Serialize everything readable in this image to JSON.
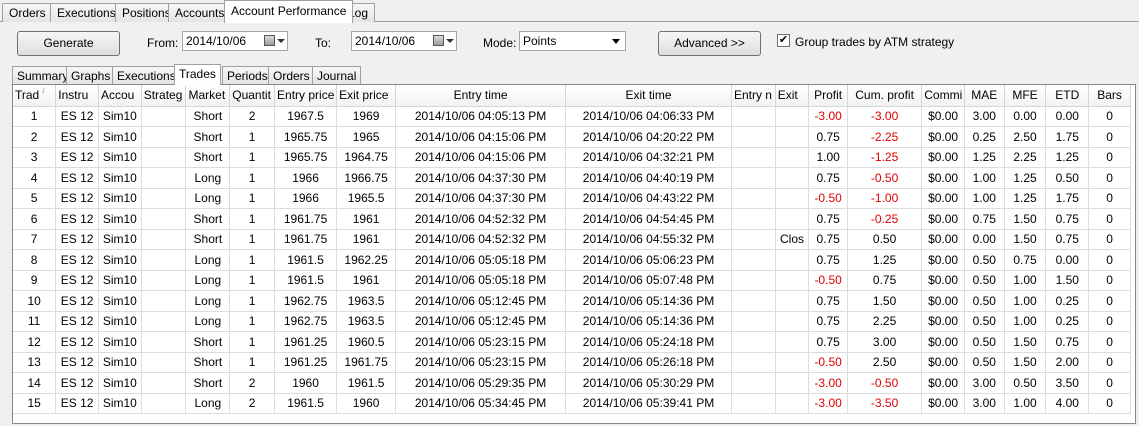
{
  "top_tabs": [
    "Orders",
    "Executions",
    "Positions",
    "Accounts",
    "Account Performance",
    "Log"
  ],
  "active_top_tab": "Account Performance",
  "toolbar": {
    "generate_label": "Generate",
    "from_label": "From:",
    "from_value": "2014/10/06",
    "to_label": "To:",
    "to_value": "2014/10/06",
    "mode_label": "Mode:",
    "mode_value": "Points",
    "advanced_label": "Advanced >>",
    "group_checkbox_label": "Group trades by ATM strategy",
    "group_checked": true
  },
  "sub_tabs": [
    "Summary",
    "Graphs",
    "Executions",
    "Trades",
    "Periods",
    "Orders",
    "Journal"
  ],
  "active_sub_tab": "Trades",
  "colors": {
    "negative": "#e00000"
  },
  "table": {
    "columns": [
      "Trad",
      "Instru",
      "Accou",
      "Strateg",
      "Market",
      "Quantit",
      "Entry price",
      "Exit price",
      "Entry time",
      "Exit time",
      "Entry n",
      "Exit",
      "Profit",
      "Cum. profit",
      "Commi",
      "MAE",
      "MFE",
      "ETD",
      "Bars"
    ],
    "rows": [
      [
        "1",
        "ES 12",
        "Sim10",
        "",
        "Short",
        "2",
        "1967.5",
        "1969",
        "2014/10/06 04:05:13 PM",
        "2014/10/06 04:06:33 PM",
        "",
        "",
        "-3.00",
        "-3.00",
        "$0.00",
        "3.00",
        "0.00",
        "0.00",
        "0"
      ],
      [
        "2",
        "ES 12",
        "Sim10",
        "",
        "Short",
        "1",
        "1965.75",
        "1965",
        "2014/10/06 04:15:06 PM",
        "2014/10/06 04:20:22 PM",
        "",
        "",
        "0.75",
        "-2.25",
        "$0.00",
        "0.25",
        "2.50",
        "1.75",
        "0"
      ],
      [
        "3",
        "ES 12",
        "Sim10",
        "",
        "Short",
        "1",
        "1965.75",
        "1964.75",
        "2014/10/06 04:15:06 PM",
        "2014/10/06 04:32:21 PM",
        "",
        "",
        "1.00",
        "-1.25",
        "$0.00",
        "1.25",
        "2.25",
        "1.25",
        "0"
      ],
      [
        "4",
        "ES 12",
        "Sim10",
        "",
        "Long",
        "1",
        "1966",
        "1966.75",
        "2014/10/06 04:37:30 PM",
        "2014/10/06 04:40:19 PM",
        "",
        "",
        "0.75",
        "-0.50",
        "$0.00",
        "1.00",
        "1.25",
        "0.50",
        "0"
      ],
      [
        "5",
        "ES 12",
        "Sim10",
        "",
        "Long",
        "1",
        "1966",
        "1965.5",
        "2014/10/06 04:37:30 PM",
        "2014/10/06 04:43:22 PM",
        "",
        "",
        "-0.50",
        "-1.00",
        "$0.00",
        "1.00",
        "1.25",
        "1.75",
        "0"
      ],
      [
        "6",
        "ES 12",
        "Sim10",
        "",
        "Short",
        "1",
        "1961.75",
        "1961",
        "2014/10/06 04:52:32 PM",
        "2014/10/06 04:54:45 PM",
        "",
        "",
        "0.75",
        "-0.25",
        "$0.00",
        "0.75",
        "1.50",
        "0.75",
        "0"
      ],
      [
        "7",
        "ES 12",
        "Sim10",
        "",
        "Short",
        "1",
        "1961.75",
        "1961",
        "2014/10/06 04:52:32 PM",
        "2014/10/06 04:55:32 PM",
        "",
        "Clos",
        "0.75",
        "0.50",
        "$0.00",
        "0.00",
        "1.50",
        "0.75",
        "0"
      ],
      [
        "8",
        "ES 12",
        "Sim10",
        "",
        "Long",
        "1",
        "1961.5",
        "1962.25",
        "2014/10/06 05:05:18 PM",
        "2014/10/06 05:06:23 PM",
        "",
        "",
        "0.75",
        "1.25",
        "$0.00",
        "0.50",
        "0.75",
        "0.00",
        "0"
      ],
      [
        "9",
        "ES 12",
        "Sim10",
        "",
        "Long",
        "1",
        "1961.5",
        "1961",
        "2014/10/06 05:05:18 PM",
        "2014/10/06 05:07:48 PM",
        "",
        "",
        "-0.50",
        "0.75",
        "$0.00",
        "0.50",
        "1.00",
        "1.50",
        "0"
      ],
      [
        "10",
        "ES 12",
        "Sim10",
        "",
        "Long",
        "1",
        "1962.75",
        "1963.5",
        "2014/10/06 05:12:45 PM",
        "2014/10/06 05:14:36 PM",
        "",
        "",
        "0.75",
        "1.50",
        "$0.00",
        "0.50",
        "1.00",
        "0.25",
        "0"
      ],
      [
        "11",
        "ES 12",
        "Sim10",
        "",
        "Long",
        "1",
        "1962.75",
        "1963.5",
        "2014/10/06 05:12:45 PM",
        "2014/10/06 05:14:36 PM",
        "",
        "",
        "0.75",
        "2.25",
        "$0.00",
        "0.50",
        "1.00",
        "0.25",
        "0"
      ],
      [
        "12",
        "ES 12",
        "Sim10",
        "",
        "Short",
        "1",
        "1961.25",
        "1960.5",
        "2014/10/06 05:23:15 PM",
        "2014/10/06 05:24:18 PM",
        "",
        "",
        "0.75",
        "3.00",
        "$0.00",
        "0.50",
        "1.50",
        "0.75",
        "0"
      ],
      [
        "13",
        "ES 12",
        "Sim10",
        "",
        "Short",
        "1",
        "1961.25",
        "1961.75",
        "2014/10/06 05:23:15 PM",
        "2014/10/06 05:26:18 PM",
        "",
        "",
        "-0.50",
        "2.50",
        "$0.00",
        "0.50",
        "1.50",
        "2.00",
        "0"
      ],
      [
        "14",
        "ES 12",
        "Sim10",
        "",
        "Short",
        "2",
        "1960",
        "1961.5",
        "2014/10/06 05:29:35 PM",
        "2014/10/06 05:30:29 PM",
        "",
        "",
        "-3.00",
        "-0.50",
        "$0.00",
        "3.00",
        "0.50",
        "3.50",
        "0"
      ],
      [
        "15",
        "ES 12",
        "Sim10",
        "",
        "Long",
        "2",
        "1961.5",
        "1960",
        "2014/10/06 05:34:45 PM",
        "2014/10/06 05:39:41 PM",
        "",
        "",
        "-3.00",
        "-3.50",
        "$0.00",
        "3.00",
        "1.00",
        "4.00",
        "0"
      ]
    ]
  }
}
